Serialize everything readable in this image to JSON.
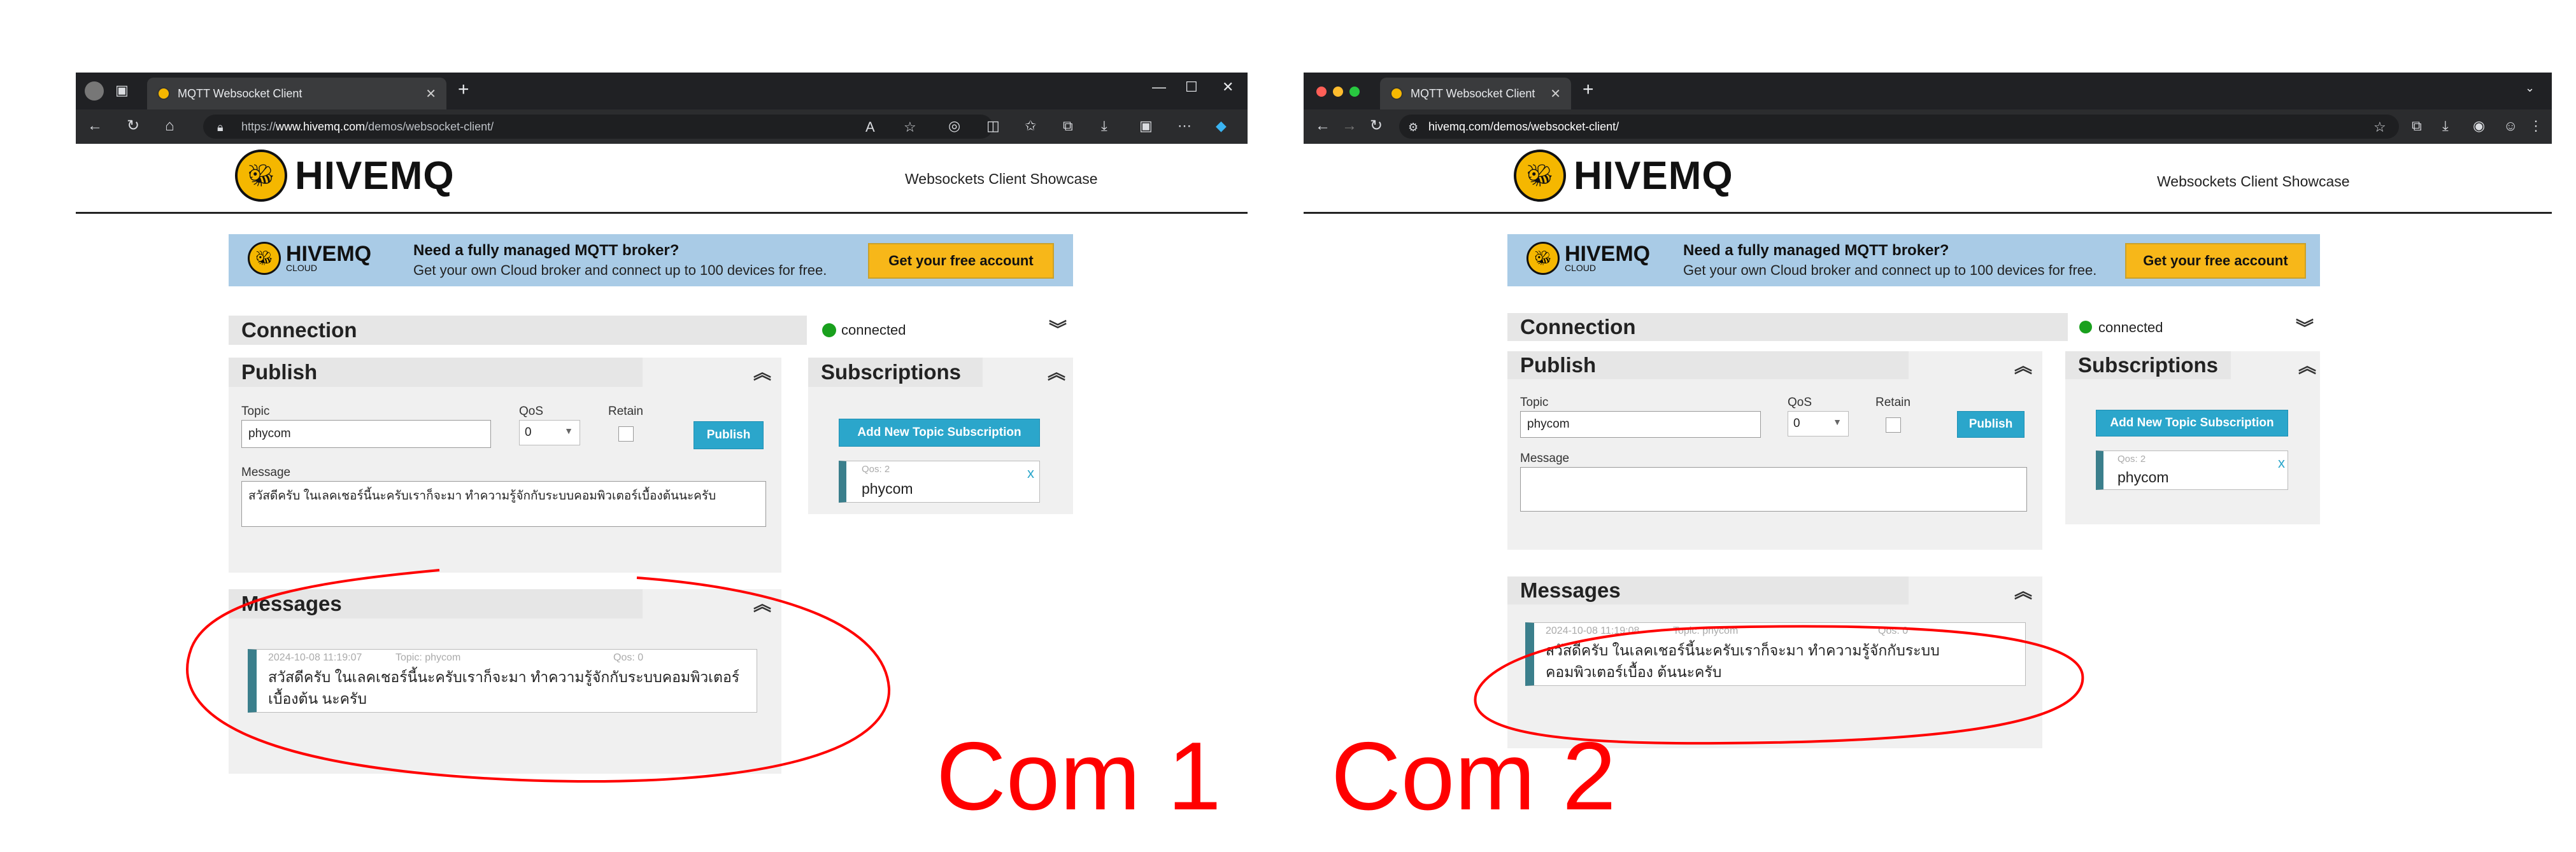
{
  "computer1": {
    "tab_title": "MQTT Websocket Client",
    "url_prefix": "https://",
    "url_host": "www.hivemq.com",
    "url_path": "/demos/websocket-client/",
    "header": {
      "logo_text": "HIVEMQ",
      "showcase": "Websockets Client Showcase"
    },
    "banner": {
      "logo_text": "HIVEMQ",
      "logo_sub": "CLOUD",
      "headline": "Need a fully managed MQTT broker?",
      "subline": "Get your own Cloud broker and connect up to 100 devices for free.",
      "button": "Get your free account"
    },
    "connection": {
      "title": "Connection",
      "status": "connected"
    },
    "publish": {
      "title": "Publish",
      "topic_label": "Topic",
      "topic_value": "phycom",
      "qos_label": "QoS",
      "qos_value": "0",
      "retain_label": "Retain",
      "publish_button": "Publish",
      "message_label": "Message",
      "message_value": "สวัสดีครับ ในเลคเชอร์นี้นะครับเราก็จะมา ทำความรู้จักกับระบบคอมพิวเตอร์เบื้องต้นนะครับ"
    },
    "subscriptions": {
      "title": "Subscriptions",
      "add_button": "Add New Topic Subscription",
      "items": [
        {
          "qos": "Qos: 2",
          "topic": "phycom",
          "remove": "x"
        }
      ]
    },
    "messages": {
      "title": "Messages",
      "items": [
        {
          "time": "2024-10-08 11:19:07",
          "topic": "Topic: phycom",
          "qos": "Qos: 0",
          "text": "สวัสดีครับ ในเลคเชอร์นี้นะครับเราก็จะมา ทำความรู้จักกับระบบคอมพิวเตอร์เบื้องต้น นะครับ"
        }
      ]
    },
    "caption": "Com 1"
  },
  "computer2": {
    "tab_title": "MQTT Websocket Client",
    "url": "hivemq.com/demos/websocket-client/",
    "header": {
      "logo_text": "HIVEMQ",
      "showcase": "Websockets Client Showcase"
    },
    "banner": {
      "logo_text": "HIVEMQ",
      "logo_sub": "CLOUD",
      "headline": "Need a fully managed MQTT broker?",
      "subline": "Get your own Cloud broker and connect up to 100 devices for free.",
      "button": "Get your free account"
    },
    "connection": {
      "title": "Connection",
      "status": "connected"
    },
    "publish": {
      "title": "Publish",
      "topic_label": "Topic",
      "topic_value": "phycom",
      "qos_label": "QoS",
      "qos_value": "0",
      "retain_label": "Retain",
      "publish_button": "Publish",
      "message_label": "Message",
      "message_value": ""
    },
    "subscriptions": {
      "title": "Subscriptions",
      "add_button": "Add New Topic Subscription",
      "items": [
        {
          "qos": "Qos: 2",
          "topic": "phycom",
          "remove": "x"
        }
      ]
    },
    "messages": {
      "title": "Messages",
      "items": [
        {
          "time": "2024-10-08 11:19:08",
          "topic": "Topic: phycom",
          "qos": "Qos: 0",
          "text": "สวัสดีครับ ในเลคเชอร์นี้นะครับเราก็จะมา ทำความรู้จักกับระบบคอมพิวเตอร์เบื้อง ต้นนะครับ"
        }
      ]
    },
    "caption": "Com 2"
  },
  "colors": {
    "annotation": "#ff0000",
    "accent": "#2ba6cb",
    "button_yellow": "#f7b719",
    "status_green": "#19a01d",
    "banner_blue": "#a9cbe6"
  },
  "icons": [
    "back-icon",
    "forward-icon",
    "reload-icon",
    "home-icon",
    "lock-icon",
    "star-icon",
    "extensions-icon",
    "download-icon",
    "more-icon",
    "chevron-up-icon",
    "chevron-down-icon"
  ]
}
